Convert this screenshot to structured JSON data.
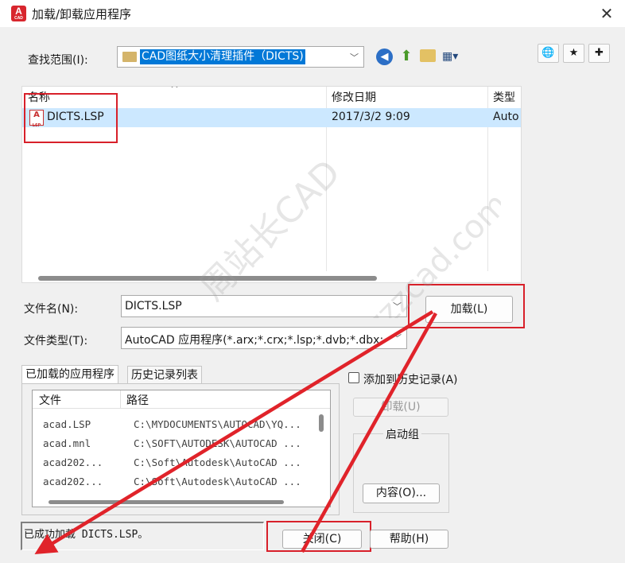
{
  "window": {
    "title": "加载/卸载应用程序",
    "close_glyph": "✕",
    "app_icon": {
      "letter": "A",
      "sub": "CAD"
    }
  },
  "lookin": {
    "label": "查找范围(I):",
    "value": "CAD图纸大小清理插件（DICTS)"
  },
  "toolbar_icons": [
    "back-icon",
    "up-folder-icon",
    "new-folder-icon",
    "views-icon",
    "web-icon",
    "favorites-icon",
    "add-favorites-icon"
  ],
  "filelist": {
    "columns": [
      "名称",
      "修改日期",
      "类型"
    ],
    "sort_glyph": "^",
    "rows": [
      {
        "name": "DICTS.LSP",
        "date": "2017/3/2 9:09",
        "type": "Auto",
        "icon_sub": "LSP"
      }
    ]
  },
  "filename": {
    "label": "文件名(N):",
    "value": "DICTS.LSP"
  },
  "filetype": {
    "label": "文件类型(T):",
    "value": "AutoCAD 应用程序(*.arx;*.crx;*.lsp;*.dvb;*.dbx;"
  },
  "load_button": "加载(L)",
  "tabs": [
    {
      "label": "已加载的应用程序",
      "active": true
    },
    {
      "label": "历史记录列表",
      "active": false
    }
  ],
  "applist": {
    "columns": [
      "文件",
      "路径"
    ],
    "rows": [
      {
        "file": "acad.LSP",
        "path": "C:\\MYDOCUMENTS\\AUTOCAD\\YQ..."
      },
      {
        "file": "acad.mnl",
        "path": "C:\\SOFT\\AUTODESK\\AUTOCAD ..."
      },
      {
        "file": "acad202...",
        "path": "C:\\Soft\\Autodesk\\AutoCAD ..."
      },
      {
        "file": "acad202...",
        "path": "C:\\Soft\\Autodesk\\AutoCAD ..."
      }
    ]
  },
  "add_history": {
    "label": "添加到历史记录(A)",
    "checked": false
  },
  "unload_button": "卸载(U)",
  "startup_group": {
    "label": "启动组",
    "contents_button": "内容(O)..."
  },
  "status_text": "已成功加载 DICTS.LSP。",
  "close_button": "关闭(C)",
  "help_button": "帮助(H)",
  "watermark": {
    "line1": "周站长CAD",
    "line2": "www.zzzcad.com"
  },
  "colors": {
    "highlight_red": "#d8202a",
    "selection": "#cce8ff",
    "folder": "#d4b46a",
    "app_red": "#d8262e"
  }
}
